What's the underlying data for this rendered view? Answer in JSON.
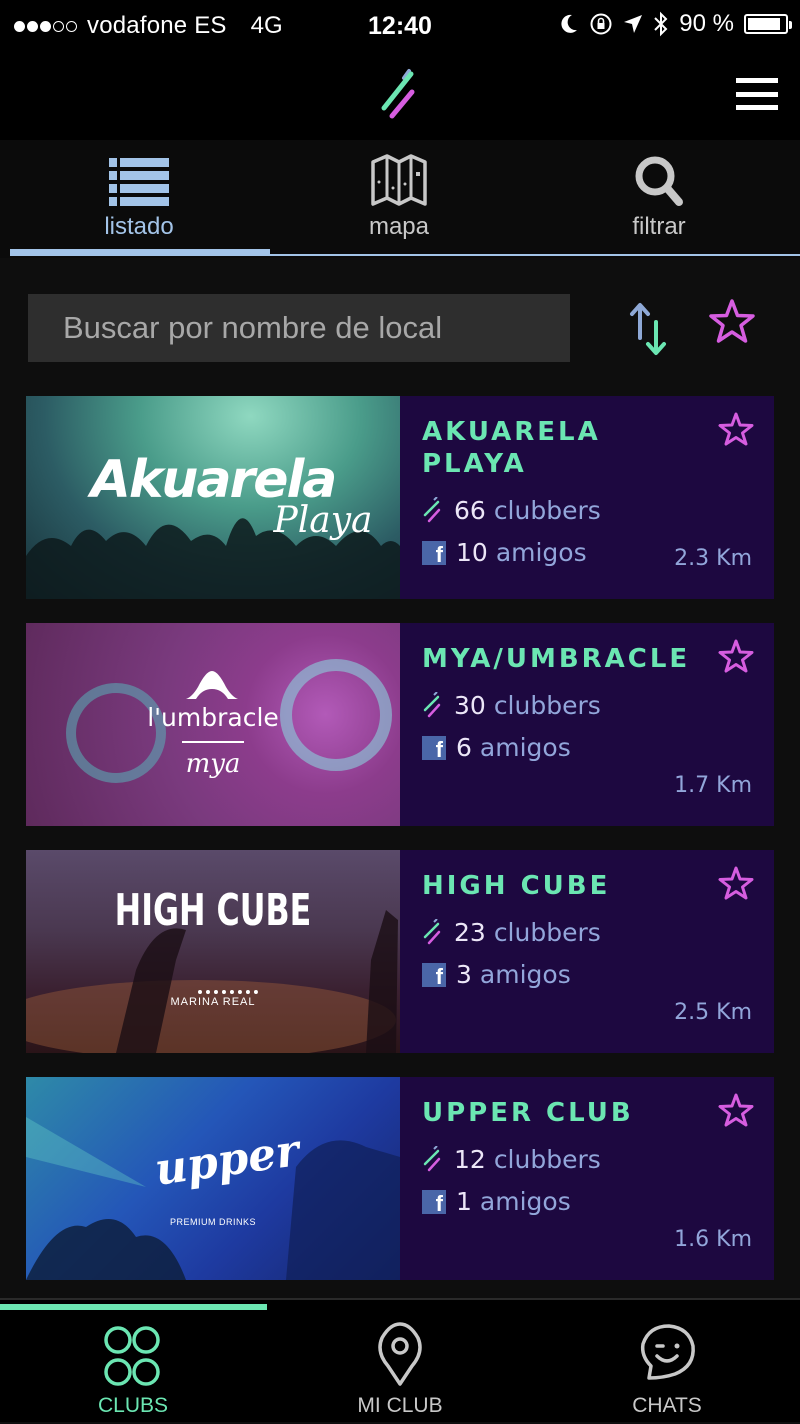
{
  "status_bar": {
    "signal_dots_filled": 3,
    "signal_dots_total": 5,
    "carrier": "vodafone ES",
    "network": "4G",
    "time": "12:40",
    "battery_percent_label": "90 %",
    "battery_level": 0.9,
    "icons": [
      "moon-icon",
      "rotation-lock-icon",
      "location-arrow-icon",
      "bluetooth-icon"
    ]
  },
  "app_bar": {
    "logo": "app-logo-slashes",
    "menu_icon": "hamburger-menu-icon"
  },
  "view_tabs": [
    {
      "label": "listado",
      "icon": "list-icon",
      "active": true
    },
    {
      "label": "mapa",
      "icon": "map-icon",
      "active": false
    },
    {
      "label": "filtrar",
      "icon": "search-icon",
      "active": false
    }
  ],
  "search": {
    "placeholder": "Buscar por nombre de local",
    "value": ""
  },
  "toolbar": {
    "sort_icon": "sort-arrows-icon",
    "favorites_icon": "star-outline-icon"
  },
  "clubs": [
    {
      "name": "AKUAREL A PLAYA",
      "display_name": "AKUARELA PLAYA",
      "image_logo": "Akuarela",
      "image_logo_sub": "Playa",
      "clubbers_count": "66",
      "clubbers_label": "clubbers",
      "friends_count": "10",
      "friends_label": "amigos",
      "distance": "2.3 Km"
    },
    {
      "name": "MYA/UMBRACLE",
      "display_name": "MYA/UMBRACLE",
      "image_logo": "l'umbracle",
      "image_logo_sub": "mya",
      "clubbers_count": "30",
      "clubbers_label": "clubbers",
      "friends_count": "6",
      "friends_label": "amigos",
      "distance": "1.7 Km"
    },
    {
      "name": "HIGH CUBE",
      "display_name": "HIGH CUBE",
      "image_logo": "HIGH CUBE",
      "image_logo_sub": "MARINA REAL",
      "clubbers_count": "23",
      "clubbers_label": "clubbers",
      "friends_count": "3",
      "friends_label": "amigos",
      "distance": "2.5 Km"
    },
    {
      "name": "UPPER CLUB",
      "display_name": "UPPER CLUB",
      "image_logo": "upper",
      "image_logo_sub": "PREMIUM DRINKS",
      "clubbers_count": "12",
      "clubbers_label": "clubbers",
      "friends_count": "1",
      "friends_label": "amigos",
      "distance": "1.6 Km"
    }
  ],
  "bottom_nav": [
    {
      "label": "CLUBS",
      "icon": "four-circles-icon",
      "active": true
    },
    {
      "label": "MI CLUB",
      "icon": "map-pin-icon",
      "active": false
    },
    {
      "label": "CHATS",
      "icon": "chat-smiley-icon",
      "active": false
    }
  ],
  "colors": {
    "accent_green": "#6be6b2",
    "accent_blue": "#a3c4e8",
    "accent_pink": "#d65de0",
    "card_bg": "#1d0840",
    "facebook_blue": "#4a66a8"
  }
}
